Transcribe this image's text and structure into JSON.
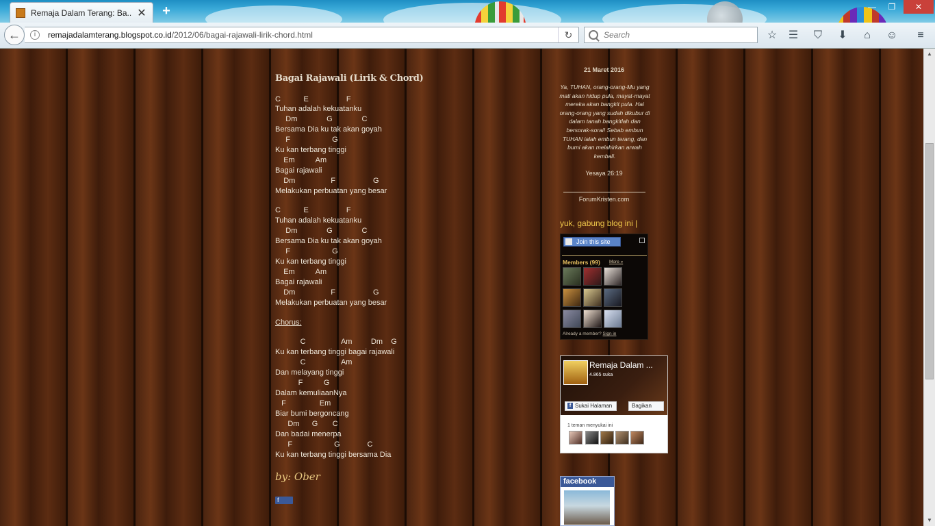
{
  "browser": {
    "tab_title": "Remaja Dalam Terang: Ba...",
    "url_host": "remajadalamterang.blogspot.co.id",
    "url_path": "/2012/06/bagai-rajawali-lirik-chord.html",
    "search_placeholder": "Search",
    "icons": {
      "back": "back-arrow-icon",
      "info": "info-icon",
      "reload": "reload-icon",
      "search": "search-icon",
      "bookmark": "bookmark-star-icon",
      "reader": "reading-list-icon",
      "pocket": "pocket-icon",
      "download": "download-icon",
      "home": "home-icon",
      "feedback": "smiley-icon",
      "menu": "hamburger-menu-icon"
    }
  },
  "post": {
    "title": "Bagai Rajawali (Lirik & Chord)",
    "lines": [
      "C           E                  F",
      "Tuhan adalah kekuatanku",
      "     Dm              G              C",
      "Bersama Dia ku tak akan goyah",
      "     F                    G",
      "Ku kan terbang tinggi",
      "    Em          Am",
      "Bagai rajawali",
      "    Dm                 F                  G",
      "Melakukan perbuatan yang besar",
      "",
      "C           E                  F",
      "Tuhan adalah kekuatanku",
      "     Dm              G              C",
      "Bersama Dia ku tak akan goyah",
      "     F                    G",
      "Ku kan terbang tinggi",
      "    Em          Am",
      "Bagai rajawali",
      "    Dm                 F                  G",
      "Melakukan perbuatan yang besar",
      "",
      "Chorus:",
      "",
      "            C                 Am         Dm    G",
      "Ku kan terbang tinggi bagai rajawali",
      "            C                 Am",
      "Dan melayang tinggi",
      "           F          G",
      "Dalam kemuliaanNya",
      "   F                Em",
      "Biar bumi bergoncang",
      "      Dm      G       C",
      "Dan badai menerpa",
      "      F                    G             C",
      "Ku kan terbang tinggi bersama Dia"
    ],
    "byline": "by: Ober"
  },
  "sidebar": {
    "date": "21 Maret 2016",
    "verse": "Ya, TUHAN, orang-orang-Mu yang mati akan hidup pula, mayat-mayat mereka akan bangkit pula. Hai orang-orang yang sudah dikubur di dalam tanah bangkitlah dan bersorak-sorai! Sebab embun TUHAN ialah embun terang, dan bumi akan melahirkan arwah kembali.",
    "verse_ref": "Yesaya 26:19",
    "source_link": "ForumKristen.com",
    "join_heading": "yuk, gabung blog ini |",
    "gfc": {
      "join_label": "Join this site",
      "members_label": "Members (99)",
      "more_label": "More »",
      "already_label": "Already a member?",
      "signin_label": "Sign in"
    },
    "fb_page": {
      "name": "Remaja Dalam ...",
      "likes": "4.865 suka",
      "like_label": "Sukai Halaman",
      "share_label": "Bagikan",
      "friends_label": "1 teman menyukai ini"
    },
    "fb_badge": {
      "label": "facebook"
    }
  }
}
